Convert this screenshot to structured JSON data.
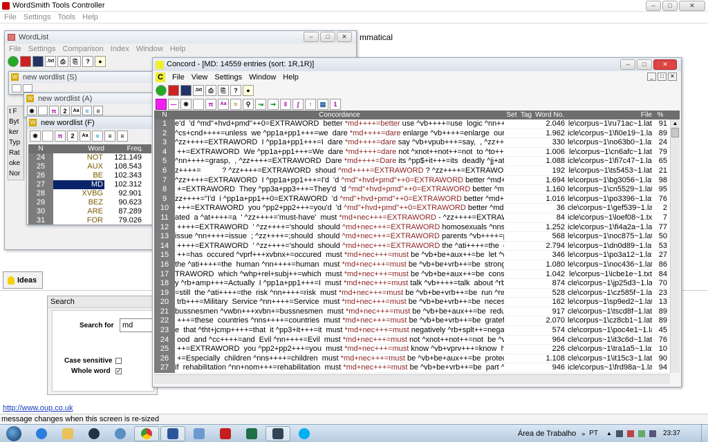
{
  "app": {
    "title": "WordSmith Tools Controller",
    "menu": [
      "File",
      "Settings",
      "Tools",
      "Help"
    ],
    "background_text": "mmatical",
    "link": "http://www.oup.co.uk",
    "status_message": "message changes when this screen is re-sized",
    "ideas_label": "Ideas"
  },
  "search": {
    "title": "Search",
    "search_for_label": "Search for",
    "search_value": "md",
    "case_sensitive_label": "Case sensitive",
    "whole_word_label": "Whole word",
    "case_sensitive": false,
    "whole_word": true
  },
  "wordlist": {
    "title": "WordList",
    "menu": [
      "File",
      "Settings",
      "Comparison",
      "Index",
      "Window",
      "Help"
    ],
    "sub_s": "new wordlist (S)",
    "sub_a": "new wordlist (A)",
    "sub_f": "new wordlist (F)",
    "left_labels": [
      "t F",
      "Byt",
      "ker",
      "Typ",
      "Rat",
      "oke",
      "Nor"
    ],
    "headers": {
      "n": "N",
      "word": "Word",
      "freq": "Freq."
    },
    "rows": [
      {
        "n": "24",
        "word": "NOT",
        "freq": "121.149"
      },
      {
        "n": "25",
        "word": "AUX",
        "freq": "108.543"
      },
      {
        "n": "26",
        "word": "BE",
        "freq": "102.343"
      },
      {
        "n": "27",
        "word": "MD",
        "freq": "102.312"
      },
      {
        "n": "28",
        "word": "XVBG",
        "freq": "92.901"
      },
      {
        "n": "29",
        "word": "BEZ",
        "freq": "90.623"
      },
      {
        "n": "30",
        "word": "ARE",
        "freq": "87.289"
      },
      {
        "n": "31",
        "word": "FOR",
        "freq": "79.026"
      }
    ]
  },
  "concord": {
    "title": "Concord - [MD: 14559 entries (sort: 1R,1R)]",
    "menu": [
      "File",
      "View",
      "Settings",
      "Window",
      "Help"
    ],
    "headers": {
      "n": "N",
      "concordance": "Concordance",
      "set": "Set",
      "tag": "Tag",
      "word_no": "Word No.",
      "file": "File",
      "pct": "%"
    },
    "rows": [
      [
        "1",
        "e'd  'd ^md\"+hvd+pmd\"++0=EXTRAWORD  better ",
        "*md++++=better",
        " use ^vb++++=use  logic ^nn++++",
        "2.046",
        "le\\corpus~1\\ru71ac~1.lat",
        "91"
      ],
      [
        "2",
        "^cs+cnd++++=unless  we ^pp1a+pp1+++=we  dare ",
        "*md++++=dare",
        " enlarge ^vb++++=enlarge  our ^pp$",
        "1.962",
        "icle\\corpus~1\\fi0e19~1.lat",
        "89"
      ],
      [
        "3",
        "^zz++++=EXTRAWORD  I ^pp1a+pp1+++=I  dare ",
        "*md++++=dare",
        " say ^vb+vpub+++=say,  , ^zz++++",
        "330",
        "le\\corpus~1\\no63b0~1.lat",
        "24"
      ],
      [
        "4",
        " ++=EXTRAWORD  We ^pp1a+pp1+++=We  dare ",
        "*md++++=dare",
        " not ^xnot++not++=not  to ^to++++",
        "1.006",
        "le\\corpus~1\\cn6afc~1.lat",
        "79"
      ],
      [
        "5",
        "^nn++++=grasp,  , ^zz++++=EXTRAWORD  Dare ",
        "*md++++=Dare",
        " its ^pp$+it+++=its  deadly ^jj+atrb",
        "1.088",
        "icle\\corpus~1\\fi7c47~1.lat",
        "65"
      ],
      [
        "6",
        "z++++=          ? ^zz++++=EXTRAWORD  shoud ",
        "^md++++=EXTRAWORD",
        " ? ^zz++++=EXTRAWOR",
        "192",
        "le\\corpus~1\\ts5453~1.lat",
        "21"
      ],
      [
        "7",
        "^zz++++=EXTRAWORD  I ^pp1a+pp1+++=I'd  'd ",
        "^md\"+hvd+pmd\"++0=EXTRAWORD",
        " better ^md+++",
        "1.694",
        "le\\corpus~1\\bg3056~1.lat",
        "98"
      ],
      [
        "8",
        " +=EXTRAWORD  They ^pp3a+pp3+++=They'd  'd ",
        "^md\"+hvd+pmd\"++0=EXTRAWORD",
        " better ^md+++",
        "1.160",
        "le\\corpus~1\\cn5529~1.lat",
        "95"
      ],
      [
        "9",
        "zz++++=\"I'd  i ^pp1a+pp1++0=EXTRAWORD  'd ",
        "^md\"+hvd+pmd\"++0=EXTRAWORD",
        " better ^md+++",
        "1.016",
        "le\\corpus~1\\po3396~1.lat",
        "76"
      ],
      [
        "10",
        " +++=EXTRAWORD  you ^pp2+pp2+++=you'd  'd ",
        "^md\"+hvd+pmd\"++0=EXTRAWORD",
        " better ^md+++",
        "36",
        "cle\\corpus~1\\gef539~1.lat",
        "2"
      ],
      [
        "11",
        "ated  a ^at++++=a  ' ^zz++++='must-have'  must ",
        "*md+nec+++=EXTRAWORD",
        " - ^zz++++=EXTRAW",
        "84",
        "icle\\corpus~1\\loef08~1.txt",
        "7"
      ],
      [
        "12",
        " ++++=EXTRAWORD  ' ^zz++++='should  should ",
        "^md+nec+++=EXTRAWORD",
        " homosexuals ^nns+n",
        "1.252",
        "icle\\corpus~1\\fi4a2a~1.lat",
        "77"
      ],
      [
        "13",
        "issue ^nn++++=issue  ; ^zz++++=;should  should ",
        "^md+nec+++=EXTRAWORD",
        " parents ^vb++++=par",
        "568",
        "le\\corpus~1\\noc875~1.lat",
        "50"
      ],
      [
        "14",
        " ++++=EXTRAWORD  ' ^zz++++='should  should ",
        "^md+nec+++=EXTRAWORD",
        " the ^ati++++=the  can",
        "2.794",
        "le\\corpus~1\\dn0d89~1.lat",
        "53"
      ],
      [
        "15",
        " ++=has  occured ^vprf+++xvbnx+=occured  must ",
        "*md+nec+++=must",
        " be ^vb+be+aux++=be  let ^vps",
        "346",
        "le\\corpus~1\\po3a12~1.lat",
        "27"
      ],
      [
        "16",
        "the ^ati++++=the  human ^nn++++=human  must ",
        "*md+nec+++=must",
        " be ^vb+be+vrb++=be  strong ^j",
        "1.080",
        "le\\corpus~1\\noc436~1.lat",
        "86"
      ],
      [
        "17",
        "TRAWORD  which ^whp+rel+subj++=which  must ",
        "*md+nec+++=must",
        " be ^vb+be+aux++=be  constan",
        "1.042",
        "le\\corpus~1\\icbe1e~1.txt",
        "84"
      ],
      [
        "18",
        "y ^rb+amp+++=Actually  I ^pp1a+pp1+++=I  must ",
        "*md+nec+++=must",
        " talk ^vb++++=talk  about ^rb+",
        "874",
        "cle\\corpus~1\\jp25d3~1.lat",
        "70"
      ],
      [
        "19",
        "=still  the ^ati++++=the  risk ^nn++++=risk  must ",
        "*md+nec+++=must",
        " be ^vb+be+vrb++=be  run ^nn+",
        "528",
        "cle\\corpus~1\\cz585f~1.lat",
        "23"
      ],
      [
        "20",
        " trb+++=Military  Service ^nn++++=Service  must ",
        "*md+nec+++=must",
        " be ^vb+be+vrb++=be  necessar",
        "162",
        "le\\corpus~1\\sp9ed2~1.lat",
        "13"
      ],
      [
        "21",
        "bussnesmen ^vwbn+++xvbn+=bussnesmen  must ",
        "*md+nec+++=must",
        " be ^vb+be+aux++=be  reduced",
        "917",
        "cle\\corpus~1\\tscd8f~1.lat",
        "89"
      ],
      [
        "22",
        " +++=these  countries ^nns++++=countries  must ",
        "*md+nec+++=must",
        " be ^vb+be+vrb++=be  grateful",
        "2.070",
        "le\\corpus~1\\cz8cb1~1.lat",
        "89"
      ],
      [
        "23",
        "e  that ^tht+jcmp++++=that  it ^pp3+it+++=it  must ",
        "*md+nec+++=must",
        " negatively ^rb+splt++=negativ",
        "574",
        "cle\\corpus~1\\poc4e1~1.lat",
        "45"
      ],
      [
        "24",
        " ood  and ^cc++++=and  Evil ^nn++++=Evil  must ",
        "*md+nec+++=must",
        " not ^xnot++not++=not  be ^vb",
        "964",
        "cle\\corpus~1\\it3c6d~1.lat",
        "76"
      ],
      [
        "25",
        " ++=EXTRAWORD  you ^pp2+pp2+++=you  must ",
        "*md+nec+++=must",
        " know ^vb+vprv+++=know  how",
        "226",
        "cle\\corpus~1\\tra1a5~1.lat",
        "10"
      ],
      [
        "26",
        " +=Especially  children ^nns++++=children  must ",
        "*md+nec+++=must",
        " be ^vb+be+aux++=be  protecte",
        "1.108",
        "cle\\corpus~1\\it15c3~1.lat",
        "90"
      ],
      [
        "27",
        "if  rehabilitation ^nn+nom+++=rehabilitation  must ",
        "*md+nec+++=must",
        " be ^vb+be+vrb++=be  part ^nn",
        "946",
        "icle\\corpus~1\\frd98a~1.lat",
        "94"
      ]
    ]
  },
  "taskbar": {
    "desktop_label": "Área de Trabalho",
    "lang": "PT",
    "time": "23:37"
  }
}
